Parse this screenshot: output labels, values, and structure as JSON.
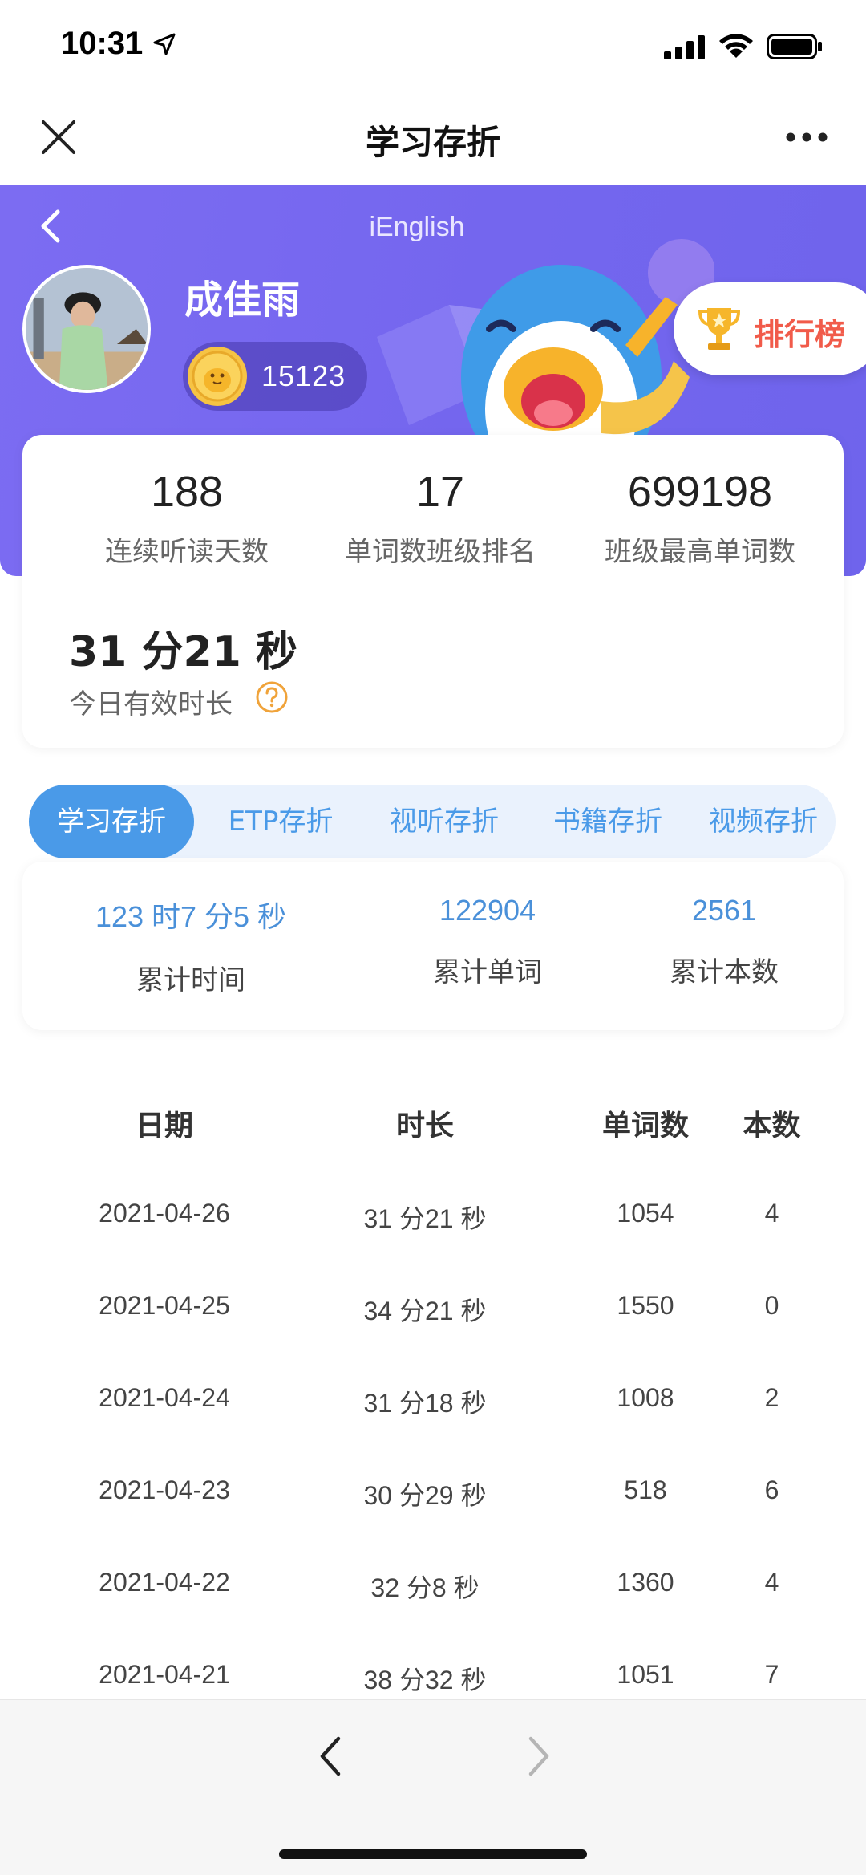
{
  "status_bar": {
    "time": "10:31"
  },
  "nav": {
    "title": "学习存折"
  },
  "header": {
    "app_name": "iEnglish",
    "user_name": "成佳雨",
    "coins": "15123",
    "rank_label": "排行榜",
    "accent_color": "#7468ee"
  },
  "stats": [
    {
      "value": "188",
      "label": "连续听读天数"
    },
    {
      "value": "17",
      "label": "单词数班级排名"
    },
    {
      "value": "699198",
      "label": "班级最高单词数"
    }
  ],
  "today": {
    "value": "31 分21 秒",
    "label": "今日有效时长"
  },
  "tabs": [
    "学习存折",
    "ETP存折",
    "视听存折",
    "书籍存折",
    "视频存折"
  ],
  "active_tab": "学习存折",
  "summary": [
    {
      "value": "123 时7 分5 秒",
      "label": "累计时间"
    },
    {
      "value": "122904",
      "label": "累计单词"
    },
    {
      "value": "2561",
      "label": "累计本数"
    }
  ],
  "table": {
    "headers": [
      "日期",
      "时长",
      "单词数",
      "本数"
    ],
    "rows": [
      [
        "2021-04-26",
        "31 分21 秒",
        "1054",
        "4"
      ],
      [
        "2021-04-25",
        "34 分21 秒",
        "1550",
        "0"
      ],
      [
        "2021-04-24",
        "31 分18 秒",
        "1008",
        "2"
      ],
      [
        "2021-04-23",
        "30 分29 秒",
        "518",
        "6"
      ],
      [
        "2021-04-22",
        "32 分8 秒",
        "1360",
        "4"
      ],
      [
        "2021-04-21",
        "38 分32 秒",
        "1051",
        "7"
      ]
    ]
  }
}
